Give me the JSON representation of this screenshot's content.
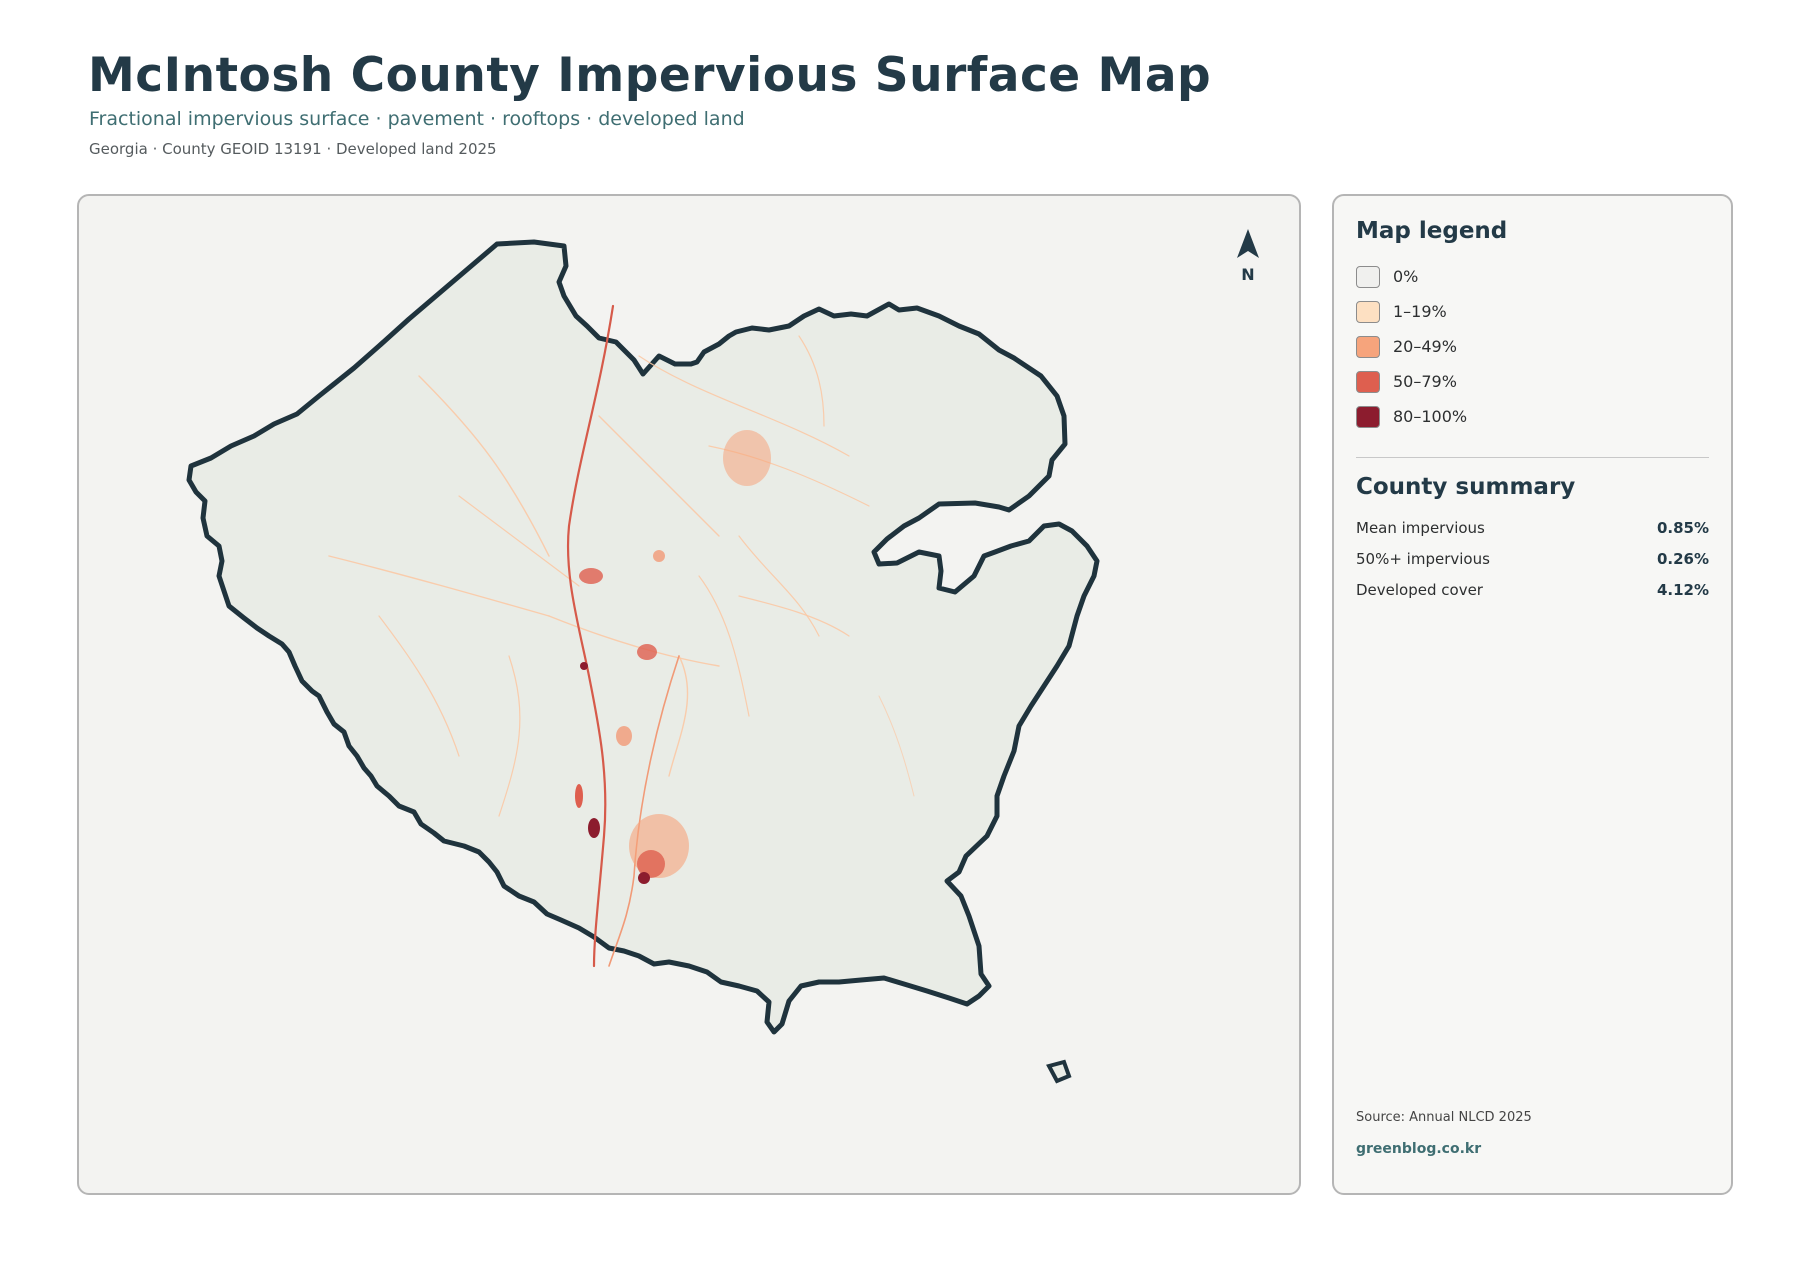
{
  "header": {
    "title": "McIntosh County Impervious Surface Map",
    "subtitle": "Fractional impervious surface · pavement · rooftops · developed land",
    "meta": "Georgia · County GEOID 13191 · Developed land 2025"
  },
  "map": {
    "north_arrow_label": "N",
    "land_color": "#e9ece6",
    "outline_color": "#1f333d"
  },
  "legend": {
    "title": "Map legend",
    "items": [
      {
        "label": "0%",
        "color": "#f0f0ee"
      },
      {
        "label": "1–19%",
        "color": "#fde0c2"
      },
      {
        "label": "20–49%",
        "color": "#f6a47c"
      },
      {
        "label": "50–79%",
        "color": "#de5f4f"
      },
      {
        "label": "80–100%",
        "color": "#8c1c2e"
      }
    ]
  },
  "summary": {
    "title": "County summary",
    "stats": [
      {
        "label": "Mean impervious",
        "value": "0.85%"
      },
      {
        "label": "50%+ impervious",
        "value": "0.26%"
      },
      {
        "label": "Developed cover",
        "value": "4.12%"
      }
    ]
  },
  "footer": {
    "source": "Source: Annual NLCD 2025",
    "brand": "greenblog.co.kr"
  }
}
